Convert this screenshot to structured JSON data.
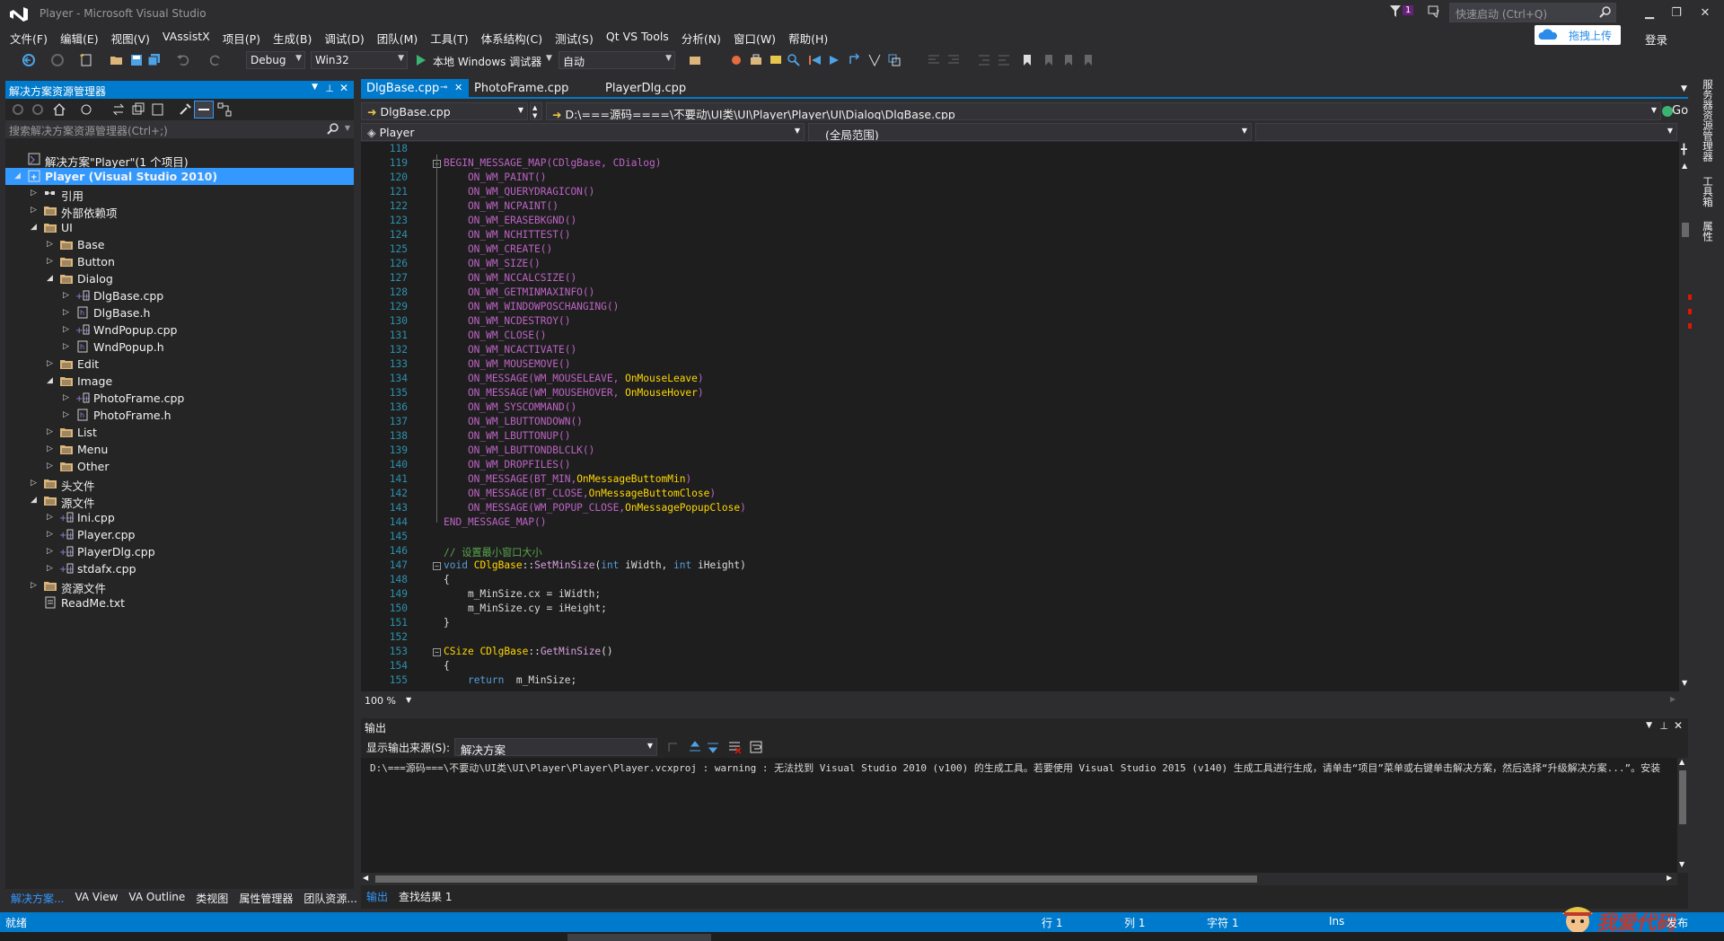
{
  "window": {
    "title": "Player - Microsoft Visual Studio",
    "notification_count": "1",
    "quick_launch_placeholder": "快速启动 (Ctrl+Q)",
    "upload_button": "拖拽上传",
    "login": "登录"
  },
  "menu": [
    "文件(F)",
    "编辑(E)",
    "视图(V)",
    "VAssistX",
    "项目(P)",
    "生成(B)",
    "调试(D)",
    "团队(M)",
    "工具(T)",
    "体系结构(C)",
    "测试(S)",
    "Qt VS Tools",
    "分析(N)",
    "窗口(W)",
    "帮助(H)"
  ],
  "toolbar": {
    "config": "Debug",
    "platform": "Win32",
    "run_label": "本地 Windows 调试器",
    "run_mode": "自动"
  },
  "solution_explorer": {
    "title": "解决方案资源管理器",
    "search_placeholder": "搜索解决方案资源管理器(Ctrl+;)",
    "tree": [
      {
        "label": "解决方案\"Player\"(1 个项目)",
        "depth": 0,
        "twisty": "",
        "icon": "solution-icon"
      },
      {
        "label": "Player (Visual Studio 2010)",
        "depth": 0,
        "twisty": "◢",
        "icon": "cpp-project-icon",
        "selected": true
      },
      {
        "label": "引用",
        "depth": 1,
        "twisty": "▷",
        "icon": "references-icon"
      },
      {
        "label": "外部依赖项",
        "depth": 1,
        "twisty": "▷",
        "icon": "filter-folder-icon"
      },
      {
        "label": "UI",
        "depth": 1,
        "twisty": "◢",
        "icon": "filter-folder-open-icon"
      },
      {
        "label": "Base",
        "depth": 2,
        "twisty": "▷",
        "icon": "filter-folder-icon"
      },
      {
        "label": "Button",
        "depth": 2,
        "twisty": "▷",
        "icon": "filter-folder-icon"
      },
      {
        "label": "Dialog",
        "depth": 2,
        "twisty": "◢",
        "icon": "filter-folder-open-icon"
      },
      {
        "label": "DlgBase.cpp",
        "depth": 3,
        "twisty": "▷",
        "icon": "cpp-file-icon"
      },
      {
        "label": "DlgBase.h",
        "depth": 3,
        "twisty": "▷",
        "icon": "header-file-icon"
      },
      {
        "label": "WndPopup.cpp",
        "depth": 3,
        "twisty": "▷",
        "icon": "cpp-file-icon"
      },
      {
        "label": "WndPopup.h",
        "depth": 3,
        "twisty": "▷",
        "icon": "header-file-icon"
      },
      {
        "label": "Edit",
        "depth": 2,
        "twisty": "▷",
        "icon": "filter-folder-icon"
      },
      {
        "label": "Image",
        "depth": 2,
        "twisty": "◢",
        "icon": "filter-folder-open-icon"
      },
      {
        "label": "PhotoFrame.cpp",
        "depth": 3,
        "twisty": "▷",
        "icon": "cpp-file-icon"
      },
      {
        "label": "PhotoFrame.h",
        "depth": 3,
        "twisty": "▷",
        "icon": "header-file-icon"
      },
      {
        "label": "List",
        "depth": 2,
        "twisty": "▷",
        "icon": "filter-folder-icon"
      },
      {
        "label": "Menu",
        "depth": 2,
        "twisty": "▷",
        "icon": "filter-folder-icon"
      },
      {
        "label": "Other",
        "depth": 2,
        "twisty": "▷",
        "icon": "filter-folder-icon"
      },
      {
        "label": "头文件",
        "depth": 1,
        "twisty": "▷",
        "icon": "filter-folder-icon"
      },
      {
        "label": "源文件",
        "depth": 1,
        "twisty": "◢",
        "icon": "filter-folder-open-icon"
      },
      {
        "label": "Ini.cpp",
        "depth": 2,
        "twisty": "▷",
        "icon": "cpp-file-icon"
      },
      {
        "label": "Player.cpp",
        "depth": 2,
        "twisty": "▷",
        "icon": "cpp-file-icon"
      },
      {
        "label": "PlayerDlg.cpp",
        "depth": 2,
        "twisty": "▷",
        "icon": "cpp-file-icon"
      },
      {
        "label": "stdafx.cpp",
        "depth": 2,
        "twisty": "▷",
        "icon": "cpp-file-icon"
      },
      {
        "label": "资源文件",
        "depth": 1,
        "twisty": "▷",
        "icon": "filter-folder-icon"
      },
      {
        "label": "ReadMe.txt",
        "depth": 1,
        "twisty": "",
        "icon": "text-file-icon"
      }
    ],
    "bottom_tabs": [
      "解决方案...",
      "VA View",
      "VA Outline",
      "类视图",
      "属性管理器",
      "团队资源..."
    ]
  },
  "editor": {
    "tabs": [
      "DlgBase.cpp",
      "PhotoFrame.cpp",
      "PlayerDlg.cpp"
    ],
    "file_combo": "DlgBase.cpp",
    "path": "D:\\===源码====\\不要动\\UI类\\UI\\Player\\Player\\UI\\Dialog\\DlgBase.cpp",
    "go_button": "Go",
    "project_combo": "Player",
    "scope_combo": "(全局范围)",
    "zoom": "100 %",
    "lines": [
      {
        "n": "118",
        "fold": "",
        "code": ""
      },
      {
        "n": "119",
        "fold": "⊟",
        "code": "BEGIN_MESSAGE_MAP(CDlgBase, CDialog)",
        "style": "mac"
      },
      {
        "n": "120",
        "fold": "",
        "code": "    ON_WM_PAINT()",
        "style": "mac"
      },
      {
        "n": "121",
        "fold": "",
        "code": "    ON_WM_QUERYDRAGICON()",
        "style": "mac"
      },
      {
        "n": "122",
        "fold": "",
        "code": "    ON_WM_NCPAINT()",
        "style": "mac"
      },
      {
        "n": "123",
        "fold": "",
        "code": "    ON_WM_ERASEBKGND()",
        "style": "mac"
      },
      {
        "n": "124",
        "fold": "",
        "code": "    ON_WM_NCHITTEST()",
        "style": "mac"
      },
      {
        "n": "125",
        "fold": "",
        "code": "    ON_WM_CREATE()",
        "style": "mac"
      },
      {
        "n": "126",
        "fold": "",
        "code": "    ON_WM_SIZE()",
        "style": "mac"
      },
      {
        "n": "127",
        "fold": "",
        "code": "    ON_WM_NCCALCSIZE()",
        "style": "mac"
      },
      {
        "n": "128",
        "fold": "",
        "code": "    ON_WM_GETMINMAXINFO()",
        "style": "mac"
      },
      {
        "n": "129",
        "fold": "",
        "code": "    ON_WM_WINDOWPOSCHANGING()",
        "style": "mac"
      },
      {
        "n": "130",
        "fold": "",
        "code": "    ON_WM_NCDESTROY()",
        "style": "mac"
      },
      {
        "n": "131",
        "fold": "",
        "code": "    ON_WM_CLOSE()",
        "style": "mac"
      },
      {
        "n": "132",
        "fold": "",
        "code": "    ON_WM_NCACTIVATE()",
        "style": "mac"
      },
      {
        "n": "133",
        "fold": "",
        "code": "    ON_WM_MOUSEMOVE()",
        "style": "mac"
      },
      {
        "n": "134",
        "fold": "",
        "code": "    ON_MESSAGE(WM_MOUSELEAVE, OnMouseLeave)",
        "style": "mac"
      },
      {
        "n": "135",
        "fold": "",
        "code": "    ON_MESSAGE(WM_MOUSEHOVER, OnMouseHover)",
        "style": "mac"
      },
      {
        "n": "136",
        "fold": "",
        "code": "    ON_WM_SYSCOMMAND()",
        "style": "mac"
      },
      {
        "n": "137",
        "fold": "",
        "code": "    ON_WM_LBUTTONDOWN()",
        "style": "mac"
      },
      {
        "n": "138",
        "fold": "",
        "code": "    ON_WM_LBUTTONUP()",
        "style": "mac"
      },
      {
        "n": "139",
        "fold": "",
        "code": "    ON_WM_LBUTTONDBLCLK()",
        "style": "mac"
      },
      {
        "n": "140",
        "fold": "",
        "code": "    ON_WM_DROPFILES()",
        "style": "mac"
      },
      {
        "n": "141",
        "fold": "",
        "code": "    ON_MESSAGE(BT_MIN,OnMessageButtomMin)",
        "style": "mac"
      },
      {
        "n": "142",
        "fold": "",
        "code": "    ON_MESSAGE(BT_CLOSE,OnMessageButtomClose)",
        "style": "mac"
      },
      {
        "n": "143",
        "fold": "",
        "code": "    ON_MESSAGE(WM_POPUP_CLOSE,OnMessagePopupClose)",
        "style": "mac"
      },
      {
        "n": "144",
        "fold": "",
        "code": "END_MESSAGE_MAP()",
        "style": "mac"
      },
      {
        "n": "145",
        "fold": "",
        "code": ""
      },
      {
        "n": "146",
        "fold": "",
        "code": "// 设置最小窗口大小",
        "style": "cmt"
      },
      {
        "n": "147",
        "fold": "⊟",
        "code": "void CDlgBase::SetMinSize(int iWidth, int iHeight)",
        "style": "fnline"
      },
      {
        "n": "148",
        "fold": "",
        "code": "{"
      },
      {
        "n": "149",
        "fold": "",
        "code": "    m_MinSize.cx = iWidth;"
      },
      {
        "n": "150",
        "fold": "",
        "code": "    m_MinSize.cy = iHeight;"
      },
      {
        "n": "151",
        "fold": "",
        "code": "}"
      },
      {
        "n": "152",
        "fold": "",
        "code": ""
      },
      {
        "n": "153",
        "fold": "⊟",
        "code": "CSize CDlgBase::GetMinSize()",
        "style": "fnline2"
      },
      {
        "n": "154",
        "fold": "",
        "code": "{"
      },
      {
        "n": "155",
        "fold": "",
        "code": "    return  m_MinSize;",
        "style": "ret"
      }
    ]
  },
  "output": {
    "title": "输出",
    "source_label": "显示输出来源(S):",
    "source_value": "解决方案",
    "text": "D:\\===源码===\\不要动\\UI类\\UI\\Player\\Player\\Player.vcxproj : warning  : 无法找到 Visual Studio 2010 (v100) 的生成工具。若要使用 Visual Studio 2015 (v140) 生成工具进行生成，请单击“项目”菜单或右键单击解决方案，然后选择“升级解决方案...”。安装",
    "tabs": [
      "输出",
      "查找结果 1"
    ]
  },
  "right_strip": [
    "服务器资源管理器",
    "工具箱",
    "属性"
  ],
  "status": {
    "ready": "就绪",
    "line": "行 1",
    "col": "列 1",
    "char": "字符 1",
    "mode": "Ins",
    "publish": "发布",
    "watermark": "我爱代码"
  },
  "colors": {
    "accent": "#007acc",
    "selection": "#3399ff",
    "macro": "#bd63c5",
    "keyword": "#569cd6",
    "comment": "#57a64a"
  }
}
